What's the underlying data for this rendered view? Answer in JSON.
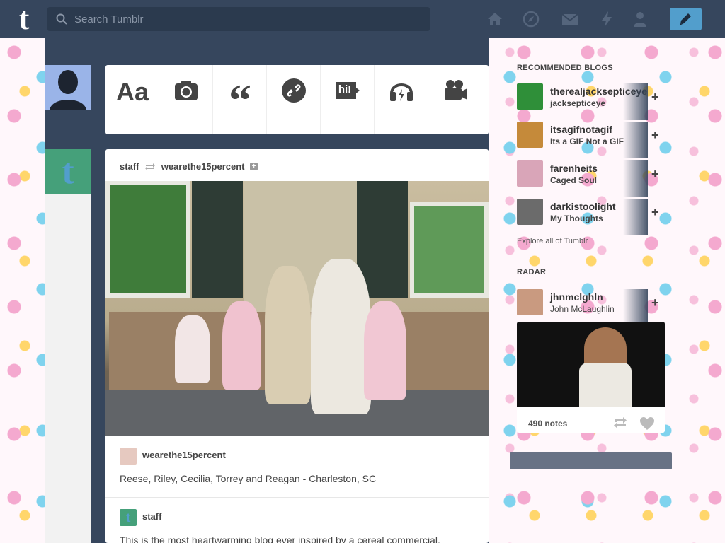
{
  "search": {
    "placeholder": "Search Tumblr"
  },
  "nav": {
    "icons": [
      "home-icon",
      "explore-compass-icon",
      "mail-icon",
      "activity-bolt-icon",
      "account-person-icon"
    ],
    "compose_icon": "pencil-icon"
  },
  "post_types": [
    {
      "name": "text",
      "glyph": "Aa"
    },
    {
      "name": "photo",
      "glyph": ""
    },
    {
      "name": "quote",
      "glyph": "“"
    },
    {
      "name": "link",
      "glyph": ""
    },
    {
      "name": "chat",
      "glyph": "hi!"
    },
    {
      "name": "audio",
      "glyph": ""
    },
    {
      "name": "video",
      "glyph": ""
    }
  ],
  "post": {
    "author": "staff",
    "reblogged_from": "wearethe15percent",
    "source_blog": "wearethe15percent",
    "caption": "Reese, Riley, Cecilia, Torrey and Reagan - Charleston, SC",
    "reblogger": "staff",
    "body": "This is the most heartwarming blog ever inspired by a cereal commercial."
  },
  "sidebar": {
    "recommended_heading": "RECOMMENDED BLOGS",
    "recommended": [
      {
        "name": "therealjacksepticeye",
        "title": "jacksepticeye",
        "color": "#2f8f39"
      },
      {
        "name": "itsagifnotagif",
        "title": "Its a GIF Not a GIF",
        "color": "#c58a3a"
      },
      {
        "name": "farenheits",
        "title": "Caged Soul",
        "color": "#d9a5b8"
      },
      {
        "name": "darkistoolight",
        "title": "My Thoughts",
        "color": "#6b6b6b"
      }
    ],
    "explore": "Explore all of Tumblr",
    "radar_heading": "RADAR",
    "radar_blog": {
      "name": "jhnmclghln",
      "title": "John McLaughlin",
      "color": "#c99a80"
    },
    "radar_notes": "490 notes"
  },
  "colors": {
    "topbar": "#36465d",
    "compose": "#529ecc",
    "card": "#ffffff"
  }
}
